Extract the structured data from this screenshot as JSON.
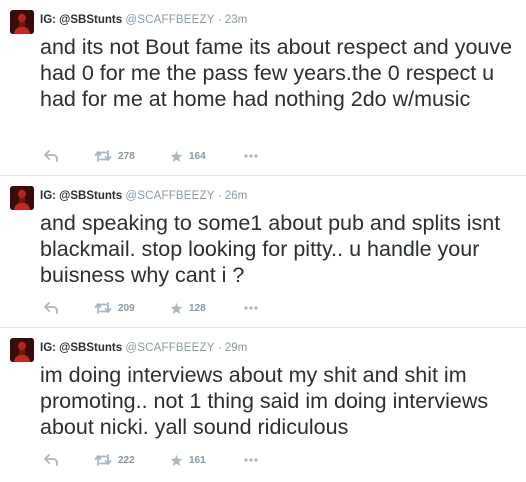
{
  "tweets": [
    {
      "name": "IG: @SBStunts",
      "handle": "@SCAFFBEEZY",
      "separator": "·",
      "time": "23m",
      "text": "and its not Bout fame its about respect and youve had 0 for me the pass few years.the 0 respect u had for me at home had nothing 2do w/music",
      "retweets": "278",
      "favorites": "164"
    },
    {
      "name": "IG: @SBStunts",
      "handle": "@SCAFFBEEZY",
      "separator": "·",
      "time": "26m",
      "text": "and speaking to some1 about pub and splits isnt blackmail. stop looking for pitty.. u handle your buisness why cant i ?",
      "retweets": "209",
      "favorites": "128"
    },
    {
      "name": "IG: @SBStunts",
      "handle": "@SCAFFBEEZY",
      "separator": "·",
      "time": "29m",
      "text": "im doing interviews about my shit and shit im promoting.. not 1 thing said im doing interviews about nicki. yall sound ridiculous",
      "retweets": "222",
      "favorites": "161"
    }
  ],
  "icons": {
    "reply": "reply-arrow-icon",
    "retweet": "retweet-icon",
    "favorite": "star-icon",
    "more": "ellipsis-icon"
  },
  "colors": {
    "text": "#292f33",
    "muted": "#8899a6",
    "icon": "#aab8c2",
    "divider": "#e1e8ed"
  }
}
